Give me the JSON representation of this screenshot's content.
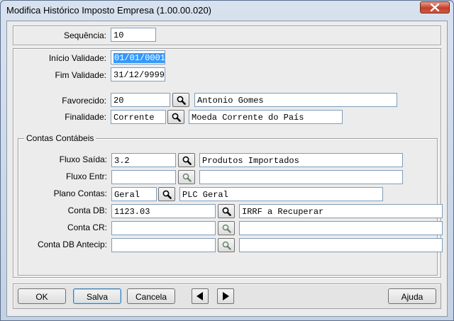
{
  "window": {
    "title": "Modifica Histórico Imposto Empresa (1.00.00.020)"
  },
  "icons": {
    "search": "magnifier-icon",
    "close": "close-icon",
    "prev": "triangle-left-icon",
    "next": "triangle-right-icon"
  },
  "fields": {
    "sequencia": {
      "label": "Sequência:",
      "value": "10"
    },
    "inicio_validade": {
      "label": "Início Validade:",
      "value": "01/01/0001"
    },
    "fim_validade": {
      "label": "Fim Validade:",
      "value": "31/12/9999"
    },
    "favorecido": {
      "label": "Favorecido:",
      "value": "20",
      "description": "Antonio Gomes"
    },
    "finalidade": {
      "label": "Finalidade:",
      "value": "Corrente",
      "description": "Moeda Corrente do País"
    }
  },
  "contas": {
    "group_title": "Contas Contábeis",
    "fluxo_saida": {
      "label": "Fluxo Saída:",
      "value": "3.2",
      "description": "Produtos Importados"
    },
    "fluxo_entr": {
      "label": "Fluxo Entr:",
      "value": "",
      "description": ""
    },
    "plano_contas": {
      "label": "Plano Contas:",
      "value": "Geral",
      "description": "PLC Geral"
    },
    "conta_db": {
      "label": "Conta DB:",
      "value": "1123.03",
      "description": "IRRF a Recuperar"
    },
    "conta_cr": {
      "label": "Conta CR:",
      "value": "",
      "description": ""
    },
    "conta_db_antecip": {
      "label": "Conta DB Antecip:",
      "value": "",
      "description": ""
    }
  },
  "buttons": {
    "ok": "OK",
    "salva": "Salva",
    "cancela": "Cancela",
    "ajuda": "Ajuda"
  }
}
